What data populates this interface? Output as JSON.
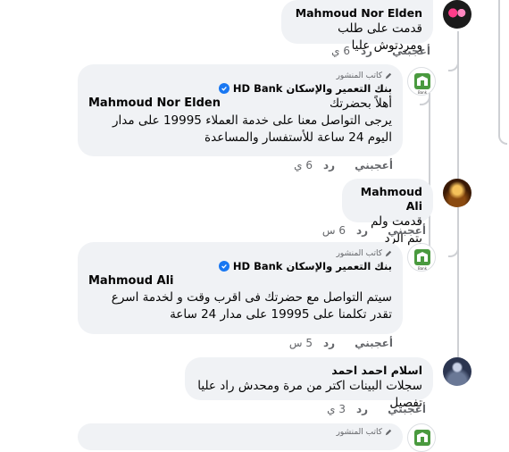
{
  "comments": [
    {
      "author": "Mahmoud Nor Elden",
      "text": "قدمت على طلب ومردتوش عليا",
      "like": "أعجبني",
      "reply": "رد",
      "time": "6 ي"
    },
    {
      "author_badge": "كاتب المنشور",
      "page_name": "بنك التعمير والإسكان HD Bank",
      "mention": "Mahmoud Nor Elden",
      "greeting": "أهلاً بحضرتك",
      "text": "يرجى التواصل معنا على خدمة العملاء 19995 على مدار اليوم 24 ساعة للأستفسار والمساعدة",
      "like": "أعجبني",
      "reply": "رد",
      "time": "6 ي"
    },
    {
      "author": "Mahmoud Ali",
      "text": "قدمت ولم يتم الرد",
      "like": "أعجبني",
      "reply": "رد",
      "time": "6 س"
    },
    {
      "author_badge": "كاتب المنشور",
      "page_name": "بنك التعمير والإسكان HD Bank",
      "mention": "Mahmoud Ali",
      "text": "سيتم التواصل مع حضرتك فى اقرب وقت و لخدمة اسرع تقدر تكلمنا على 19995 على مدار 24 ساعة",
      "like": "أعجبني",
      "reply": "رد",
      "time": "5 س"
    },
    {
      "author": "اسلام احمد احمد",
      "text": "سجلات البينات اكتر من مرة ومحدش راد عليا تفصيل",
      "like": "أعجبني",
      "reply": "رد",
      "time": "3 ي"
    },
    {
      "author_badge": "كاتب المنشور"
    }
  ],
  "colors": {
    "bubble": "#f0f2f5",
    "verified": "#1877f2",
    "secondary_text": "#65676b",
    "thread_line": "#ced0d4"
  },
  "icons": [
    "verified-badge-icon",
    "author-pen-icon",
    "hd-bank-logo-icon"
  ]
}
